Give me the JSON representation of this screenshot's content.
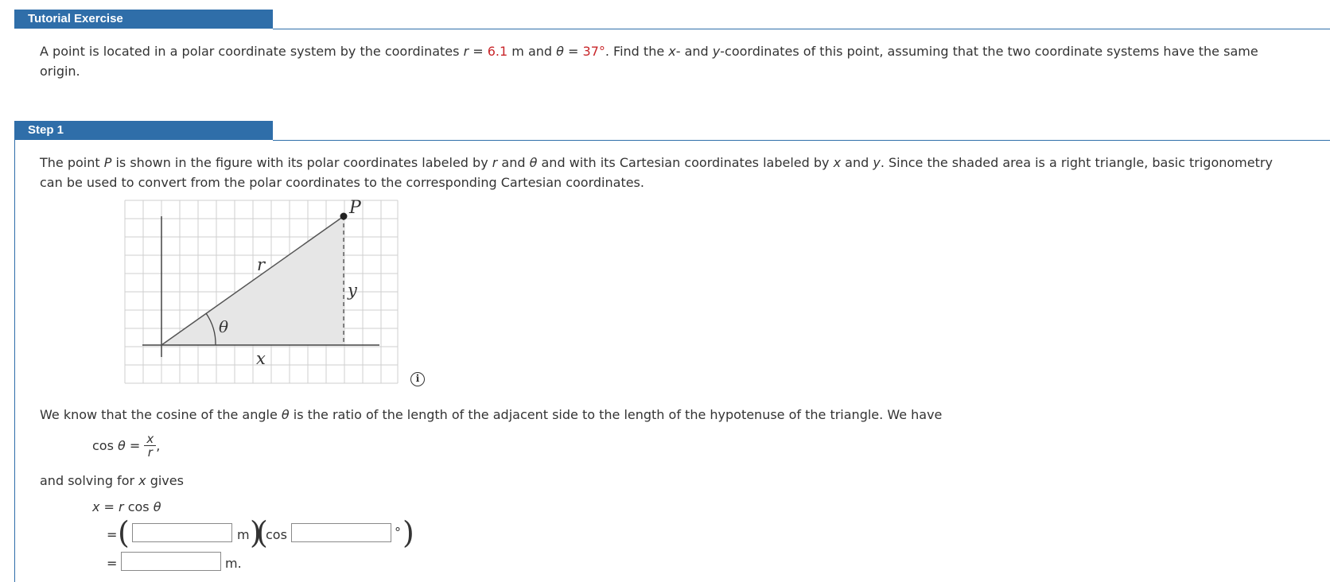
{
  "tutorial": {
    "tab_label": "Tutorial Exercise",
    "problem_p1": "A point is located in a polar coordinate system by the coordinates ",
    "r_var": "r",
    "eq": " = ",
    "r_value": "6.1",
    "r_unit": " m and ",
    "theta_var": "θ",
    "theta_value": "37°",
    "problem_p2": ". Find the ",
    "x_var": "x",
    "problem_p3": "- and ",
    "y_var": "y",
    "problem_p4": "-coordinates of this point, assuming that the two coordinate systems have the same",
    "problem_line2": "origin."
  },
  "step1": {
    "tab_label": "Step 1",
    "intro_a": "The point ",
    "P": "P",
    "intro_b": " is shown in the figure with its polar coordinates labeled by ",
    "r": "r",
    "and1": " and ",
    "theta": "θ",
    "intro_c": " and with its Cartesian coordinates labeled by ",
    "x": "x",
    "and2": " and ",
    "y": "y",
    "intro_d": ". Since the shaded area is a right triangle, basic trigonometry",
    "intro_line2": "can be used to convert from the polar coordinates to the corresponding Cartesian coordinates.",
    "figure": {
      "label_P": "P",
      "label_r": "r",
      "label_y": "y",
      "label_theta": "θ",
      "label_x": "x"
    },
    "info_icon": "i",
    "cosine_a": "We know that the cosine of the angle ",
    "cosine_theta": "θ",
    "cosine_b": " is the ratio of the length of the adjacent side to the length of the hypotenuse of the triangle. We have",
    "eq_cos_lhs": "cos ",
    "eq_cos_theta": "θ",
    "eq_cos_eq": " = ",
    "eq_frac_num": "x",
    "eq_frac_den": "r",
    "eq_comma": ",",
    "solving_a": "and solving for ",
    "solving_x": "x",
    "solving_b": " gives",
    "eq_x": "x",
    "eq_x_eq": " = ",
    "eq_x_r": "r",
    "eq_x_cos": " cos ",
    "eq_x_theta": "θ",
    "eq_equals": "=",
    "unit_m": "m",
    "cos_label": "cos",
    "degree": "°",
    "unit_m_dot": "m.",
    "input_r": {
      "value": "",
      "placeholder": ""
    },
    "input_theta": {
      "value": "",
      "placeholder": ""
    },
    "input_x": {
      "value": "",
      "placeholder": ""
    }
  }
}
